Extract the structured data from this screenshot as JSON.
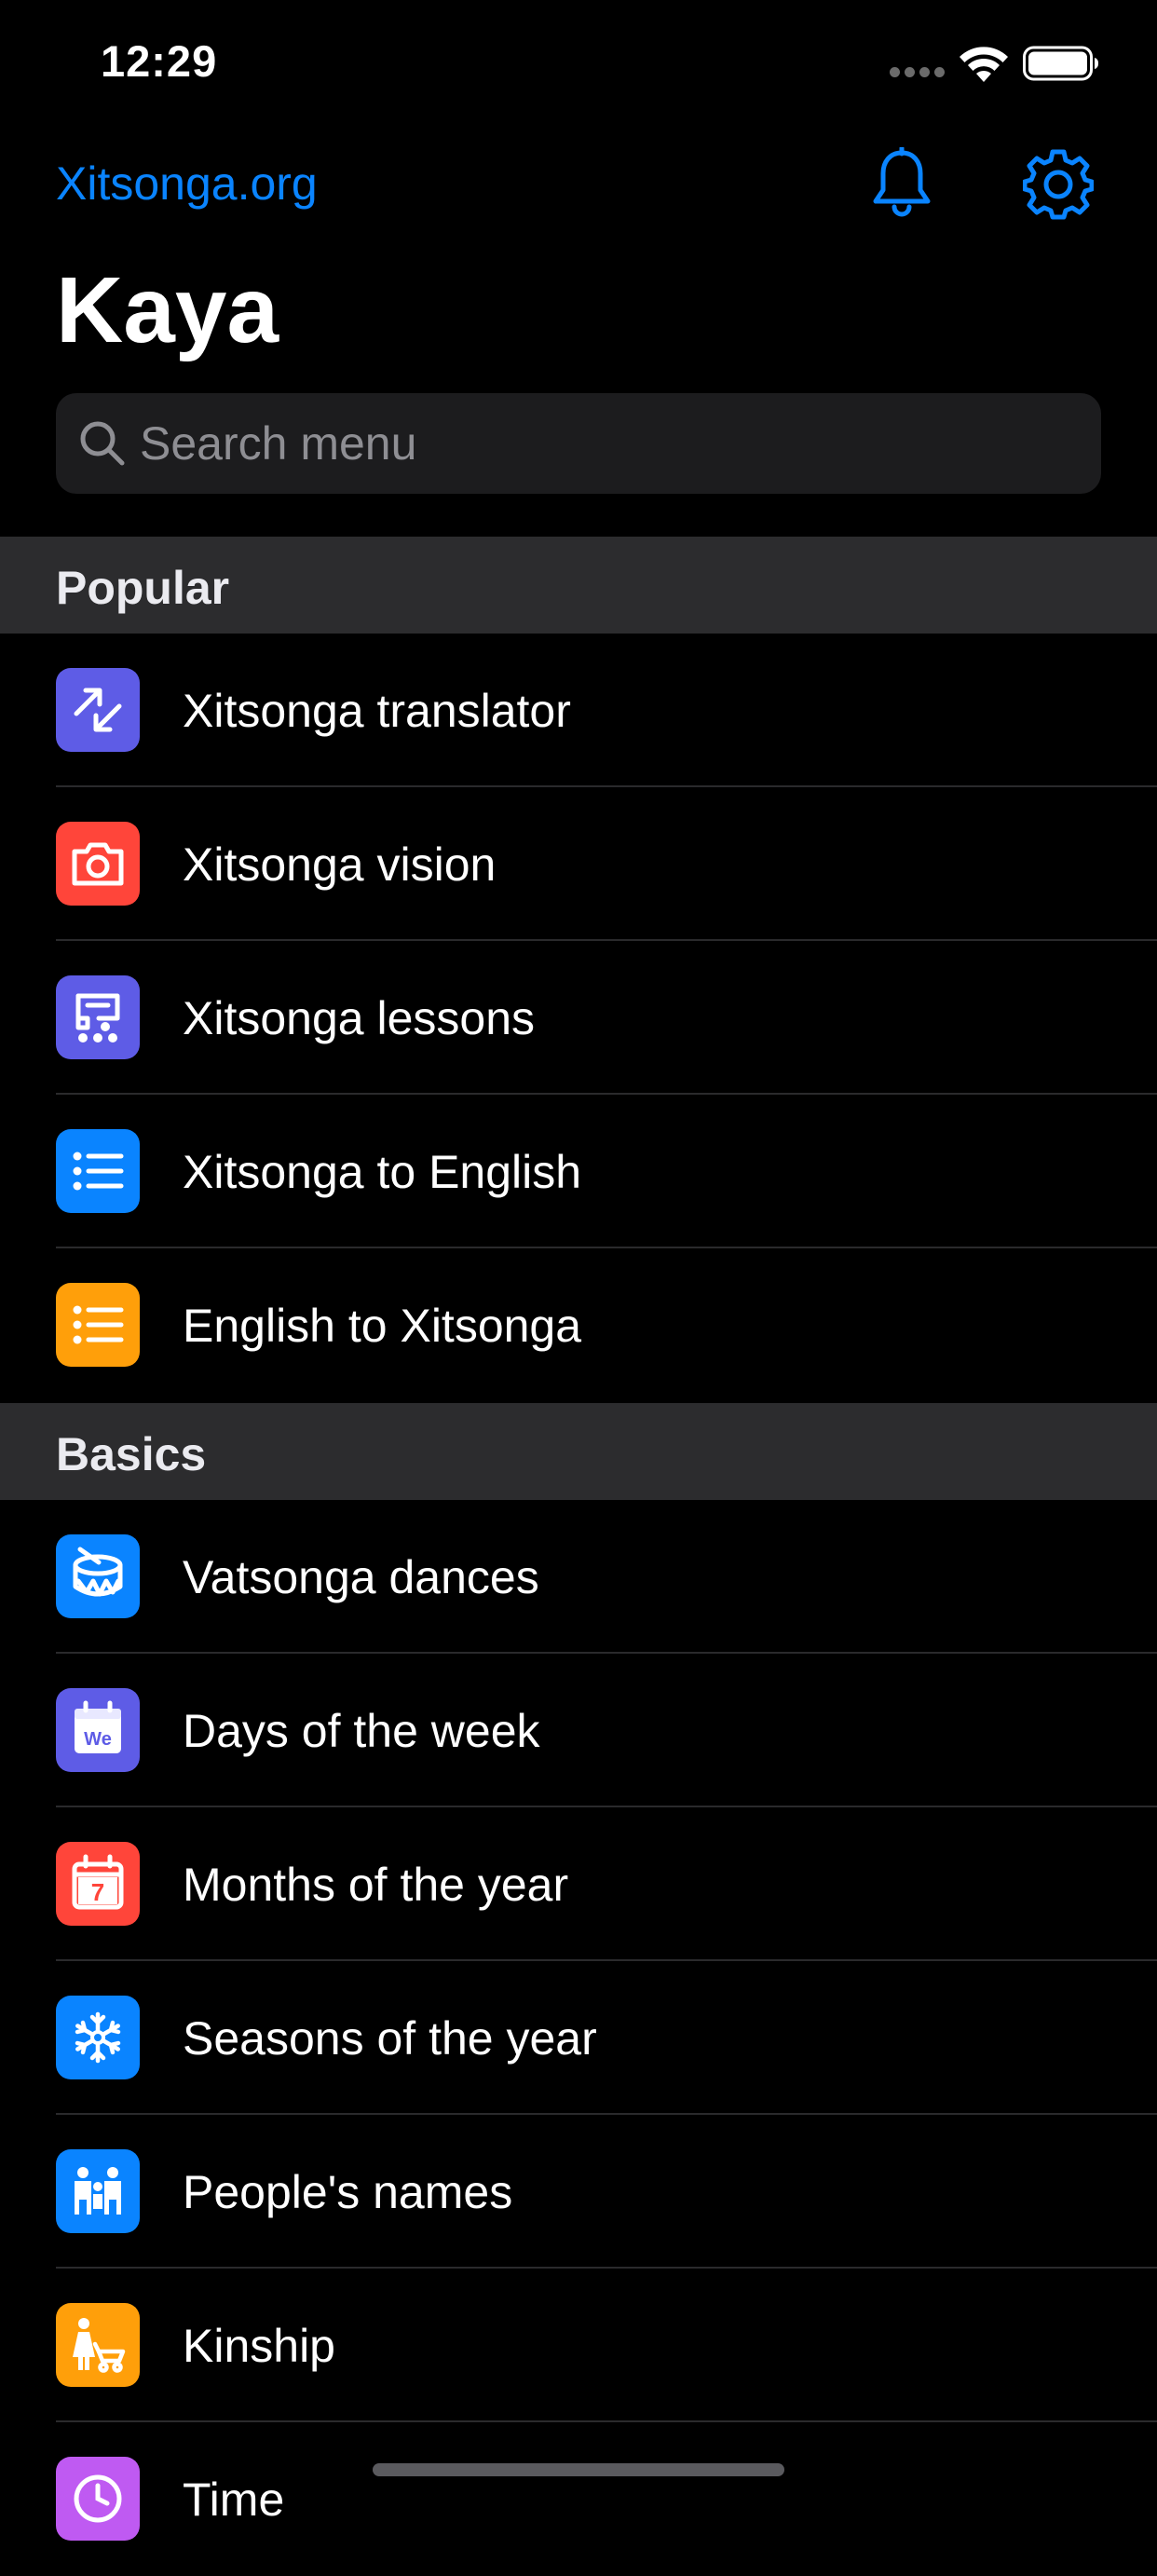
{
  "status_bar": {
    "time": "12:29"
  },
  "nav": {
    "link_label": "Xitsonga.org",
    "bell_icon": "bell-icon",
    "gear_icon": "gear-icon"
  },
  "page": {
    "title": "Kaya"
  },
  "search": {
    "placeholder": "Search menu",
    "value": ""
  },
  "colors": {
    "accent": "#0a84ff",
    "background": "#000000",
    "section_header_bg": "#2c2c2e",
    "search_bg": "#1c1c1e"
  },
  "sections": [
    {
      "title": "Popular",
      "items": [
        {
          "label": "Xitsonga translator",
          "icon": "translate-arrows-icon",
          "color": "#5e5ce6"
        },
        {
          "label": "Xitsonga vision",
          "icon": "camera-icon",
          "color": "#ff453a"
        },
        {
          "label": "Xitsonga lessons",
          "icon": "lessons-icon",
          "color": "#5e5ce6"
        },
        {
          "label": "Xitsonga to English",
          "icon": "list-icon",
          "color": "#0a84ff"
        },
        {
          "label": "English to Xitsonga",
          "icon": "list-icon",
          "color": "#ff9f0a"
        }
      ]
    },
    {
      "title": "Basics",
      "items": [
        {
          "label": "Vatsonga dances",
          "icon": "drum-icon",
          "color": "#0a84ff"
        },
        {
          "label": "Days of the week",
          "icon": "calendar-day-icon",
          "color": "#5e5ce6",
          "icon_text": "We"
        },
        {
          "label": "Months of the year",
          "icon": "calendar-month-icon",
          "color": "#ff453a",
          "icon_text": "7"
        },
        {
          "label": "Seasons of the year",
          "icon": "snowflake-icon",
          "color": "#0a84ff"
        },
        {
          "label": "People's names",
          "icon": "people-icon",
          "color": "#0a84ff"
        },
        {
          "label": "Kinship",
          "icon": "family-icon",
          "color": "#ff9f0a"
        },
        {
          "label": "Time",
          "icon": "clock-icon",
          "color": "#bf5af2"
        }
      ]
    }
  ]
}
